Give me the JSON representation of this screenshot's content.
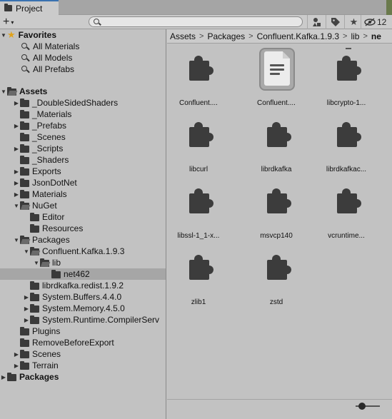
{
  "window": {
    "tab_label": "Project"
  },
  "toolbar": {
    "add_label": "+",
    "search_value": "",
    "hidden_count": "12"
  },
  "tree": {
    "favorites_label": "Favorites",
    "favorites": [
      "All Materials",
      "All Models",
      "All Prefabs"
    ],
    "assets_label": "Assets",
    "assets_children": [
      "_DoubleSidedShaders",
      "_Materials",
      "_Prefabs",
      "_Scenes",
      "_Scripts",
      "_Shaders",
      "Exports",
      "JsonDotNet",
      "Materials",
      "NuGet",
      "Editor",
      "Resources",
      "Packages",
      "Confluent.Kafka.1.9.3",
      "lib",
      "net462",
      "librdkafka.redist.1.9.2",
      "System.Buffers.4.4.0",
      "System.Memory.4.5.0",
      "System.Runtime.CompilerServ",
      "Plugins",
      "RemoveBeforeExport",
      "Scenes",
      "Terrain"
    ],
    "packages_label": "Packages"
  },
  "breadcrumb": [
    "Assets",
    "Packages",
    "Confluent.Kafka.1.9.3",
    "lib",
    "ne"
  ],
  "files": [
    {
      "label": "Confluent....",
      "icon": "plugin-icon"
    },
    {
      "label": "Confluent....",
      "icon": "document-icon"
    },
    {
      "label": "libcrypto-1...",
      "icon": "plugin-icon"
    },
    {
      "label": "libcurl",
      "icon": "plugin-icon"
    },
    {
      "label": "librdkafka",
      "icon": "plugin-icon"
    },
    {
      "label": "librdkafkac...",
      "icon": "plugin-icon"
    },
    {
      "label": "libssl-1_1-x...",
      "icon": "plugin-icon"
    },
    {
      "label": "msvcp140",
      "icon": "plugin-icon"
    },
    {
      "label": "vcruntime...",
      "icon": "plugin-icon"
    },
    {
      "label": "zlib1",
      "icon": "plugin-icon"
    },
    {
      "label": "zstd",
      "icon": "plugin-icon"
    }
  ],
  "colors": {
    "selection": "#a6a6a6",
    "tab_accent": "#3a72b0",
    "favorites_star": "#e0a21c",
    "panel_bg": "#c2c2c2"
  }
}
